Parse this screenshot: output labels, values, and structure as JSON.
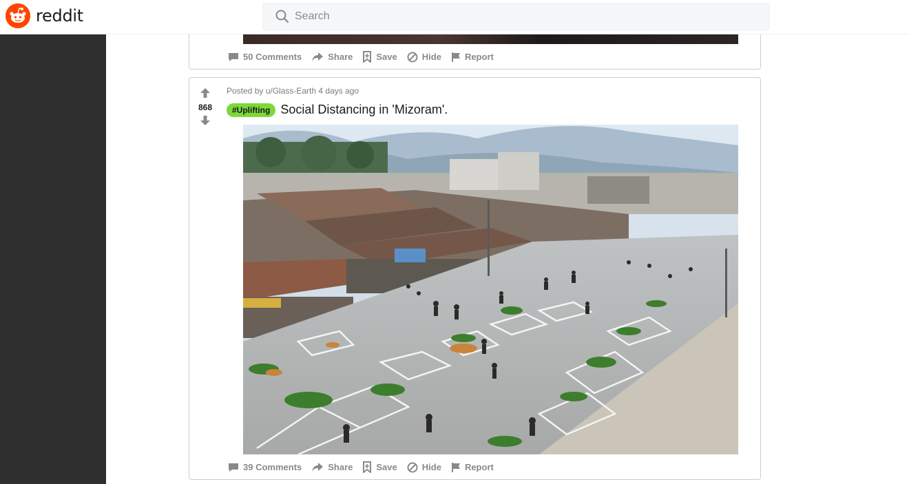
{
  "header": {
    "brand": "reddit",
    "search_placeholder": "Search"
  },
  "posts": [
    {
      "actions": {
        "comments": "50 Comments",
        "share": "Share",
        "save": "Save",
        "hide": "Hide",
        "report": "Report"
      }
    },
    {
      "meta": "Posted by u/Glass-Earth 4 days ago",
      "score": "868",
      "flair": "#Uplifting",
      "title": "Social Distancing in 'Mizoram'.",
      "actions": {
        "comments": "39 Comments",
        "share": "Share",
        "save": "Save",
        "hide": "Hide",
        "report": "Report"
      }
    }
  ],
  "colors": {
    "brand": "#ff4500",
    "flair": "#7dd93a",
    "sidebar": "#2f2f2f",
    "muted": "#878a8c"
  },
  "icons": [
    "search-icon",
    "upvote-icon",
    "downvote-icon",
    "comment-icon",
    "share-icon",
    "save-icon",
    "hide-icon",
    "report-icon"
  ]
}
